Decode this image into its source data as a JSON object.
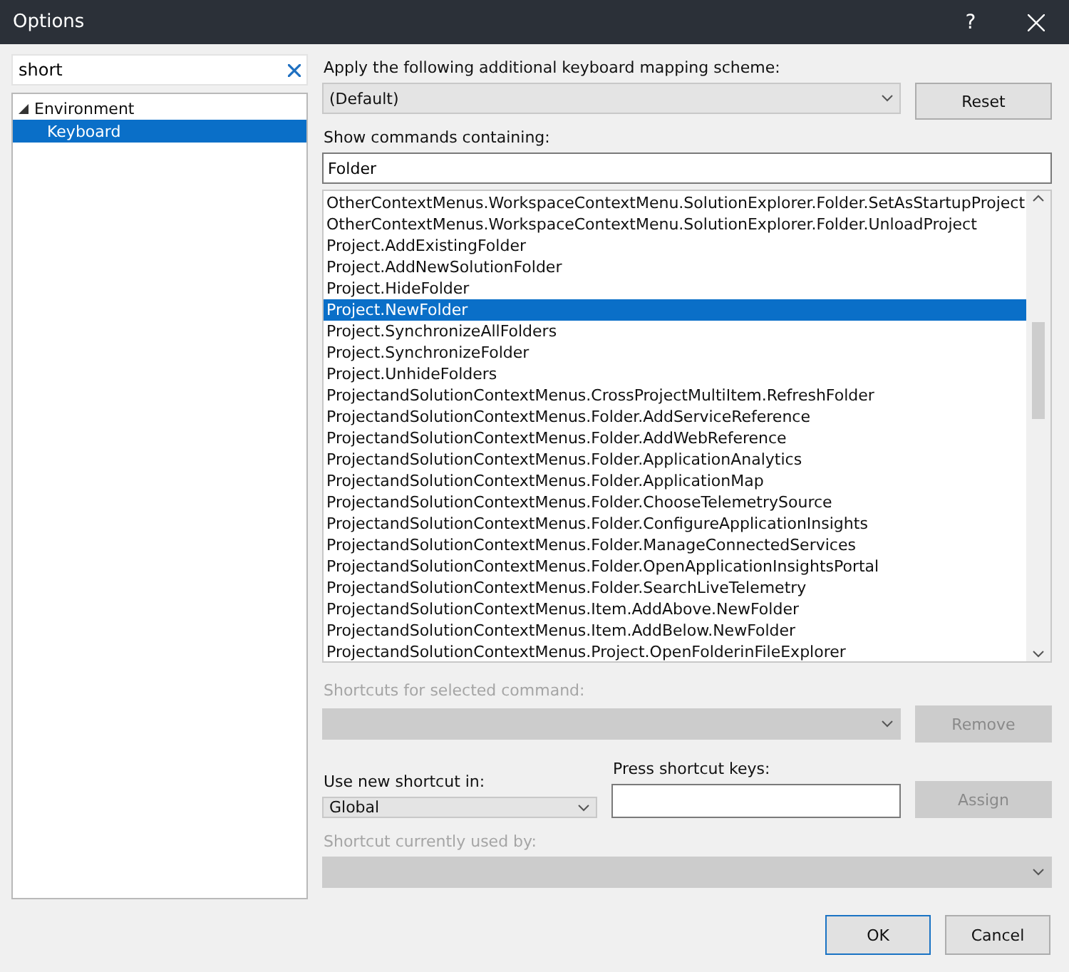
{
  "window": {
    "title": "Options",
    "help": "?"
  },
  "search": {
    "value": "short"
  },
  "tree": [
    {
      "label": "Environment",
      "expanded": true,
      "selected": false,
      "children": [
        {
          "label": "Keyboard",
          "selected": true
        }
      ]
    }
  ],
  "scheme": {
    "label": "Apply the following additional keyboard mapping scheme:",
    "value": "(Default)",
    "reset": {
      "label": "Reset",
      "disabled": false
    }
  },
  "filter": {
    "label": "Show commands containing:",
    "value": "Folder"
  },
  "commands": [
    {
      "label": "OtherContextMenus.WorkspaceContextMenu.SolutionExplorer.Folder.SetAsStartupProject",
      "selected": false
    },
    {
      "label": "OtherContextMenus.WorkspaceContextMenu.SolutionExplorer.Folder.UnloadProject",
      "selected": false
    },
    {
      "label": "Project.AddExistingFolder",
      "selected": false
    },
    {
      "label": "Project.AddNewSolutionFolder",
      "selected": false
    },
    {
      "label": "Project.HideFolder",
      "selected": false
    },
    {
      "label": "Project.NewFolder",
      "selected": true
    },
    {
      "label": "Project.SynchronizeAllFolders",
      "selected": false
    },
    {
      "label": "Project.SynchronizeFolder",
      "selected": false
    },
    {
      "label": "Project.UnhideFolders",
      "selected": false
    },
    {
      "label": "ProjectandSolutionContextMenus.CrossProjectMultiItem.RefreshFolder",
      "selected": false
    },
    {
      "label": "ProjectandSolutionContextMenus.Folder.AddServiceReference",
      "selected": false
    },
    {
      "label": "ProjectandSolutionContextMenus.Folder.AddWebReference",
      "selected": false
    },
    {
      "label": "ProjectandSolutionContextMenus.Folder.ApplicationAnalytics",
      "selected": false
    },
    {
      "label": "ProjectandSolutionContextMenus.Folder.ApplicationMap",
      "selected": false
    },
    {
      "label": "ProjectandSolutionContextMenus.Folder.ChooseTelemetrySource",
      "selected": false
    },
    {
      "label": "ProjectandSolutionContextMenus.Folder.ConfigureApplicationInsights",
      "selected": false
    },
    {
      "label": "ProjectandSolutionContextMenus.Folder.ManageConnectedServices",
      "selected": false
    },
    {
      "label": "ProjectandSolutionContextMenus.Folder.OpenApplicationInsightsPortal",
      "selected": false
    },
    {
      "label": "ProjectandSolutionContextMenus.Folder.SearchLiveTelemetry",
      "selected": false
    },
    {
      "label": "ProjectandSolutionContextMenus.Item.AddAbove.NewFolder",
      "selected": false
    },
    {
      "label": "ProjectandSolutionContextMenus.Item.AddBelow.NewFolder",
      "selected": false
    },
    {
      "label": "ProjectandSolutionContextMenus.Project.OpenFolderinFileExplorer",
      "selected": false
    }
  ],
  "shortcuts": {
    "label": "Shortcuts for selected command:",
    "disabled": true,
    "remove": {
      "label": "Remove",
      "disabled": true
    }
  },
  "scope": {
    "label": "Use new shortcut in:",
    "value": "Global"
  },
  "keys": {
    "label": "Press shortcut keys:",
    "assign": {
      "label": "Assign",
      "disabled": true
    }
  },
  "used_by": {
    "label": "Shortcut currently used by:",
    "disabled": true
  },
  "buttons": [
    {
      "label": "OK",
      "default": true
    },
    {
      "label": "Cancel",
      "default": false
    }
  ]
}
